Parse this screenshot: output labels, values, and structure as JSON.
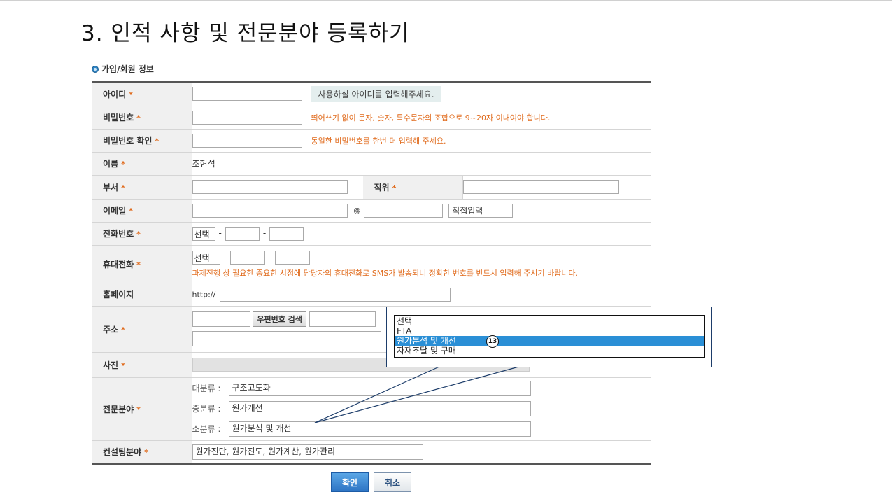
{
  "slide_title": "3. 인적 사항 및 전문분야 등록하기",
  "section_title": "가입/회원 정보",
  "rows": {
    "id": {
      "label": "아이디",
      "hint": "사용하실 아이디를 입력해주세요."
    },
    "password": {
      "label": "비밀번호",
      "hint": "띄어쓰기 없이 문자, 숫자, 특수문자의 조합으로 9~20자 이내여야 합니다."
    },
    "password_confirm": {
      "label": "비밀번호 확인",
      "hint": "동일한 비밀번호를 한번 더 입력해 주세요."
    },
    "name": {
      "label": "이름",
      "value": "조현석"
    },
    "dept": {
      "label": "부서",
      "position_label": "직위"
    },
    "email": {
      "label": "이메일",
      "at": "@",
      "direct": "직접입력"
    },
    "phone": {
      "label": "전화번호",
      "select": "선택"
    },
    "mobile": {
      "label": "휴대전화",
      "select": "선택",
      "notice": "과제진행 상 필요한 중요한 시점에 담당자의 휴대전화로 SMS가 발송되니 정확한 번호를 반드시 입력해 주시기 바랍니다."
    },
    "homepage": {
      "label": "홈페이지",
      "prefix": "http://"
    },
    "address": {
      "label": "주소",
      "search_button": "우편번호 검색"
    },
    "photo": {
      "label": "사진"
    },
    "expertise": {
      "label": "전문분야",
      "major_label": "대분류 :",
      "major_value": "구조고도화",
      "middle_label": "중분류 :",
      "middle_value": "원가개선",
      "minor_label": "소분류 :",
      "minor_value": "원가분석 및 개선"
    },
    "consulting": {
      "label": "컨설팅분야",
      "value": "원가진단, 원가진도, 원가계산, 원가관리"
    }
  },
  "required_mark": "*",
  "dropdown": {
    "options": [
      "선택",
      "FTA",
      "원가분석 및 개선",
      "자재조달 및 구매"
    ],
    "selected_index": 2,
    "badge": "13"
  },
  "buttons": {
    "ok": "확인",
    "cancel": "취소"
  }
}
